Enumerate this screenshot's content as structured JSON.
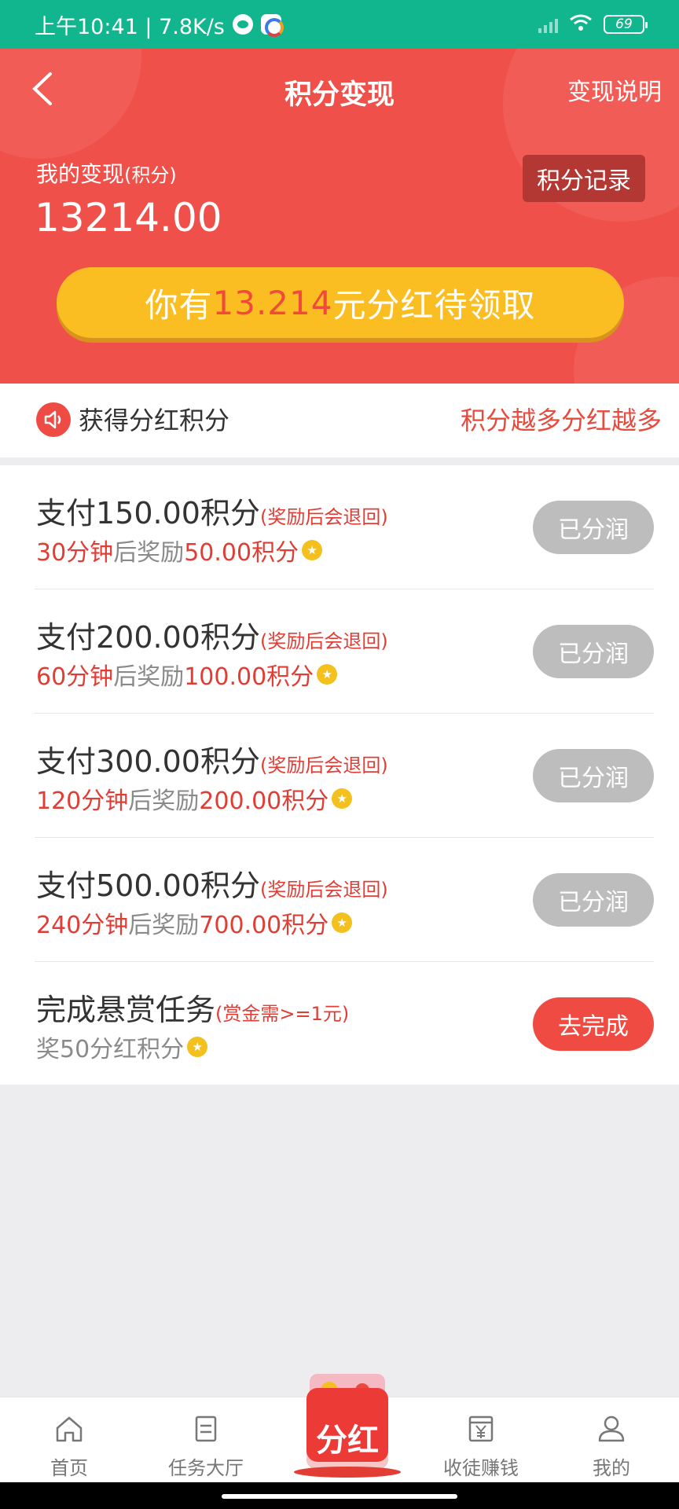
{
  "status_bar": {
    "time_speed": "上午10:41 | 7.8K/s",
    "battery": "69"
  },
  "header": {
    "title": "积分变现",
    "right_link": "变现说明",
    "my_label": "我的变现",
    "my_label_unit": "(积分)",
    "my_value": "13214.00",
    "record_button": "积分记录",
    "dividend_prefix": "你有",
    "dividend_amount": "13.214",
    "dividend_suffix": "元分红待领取"
  },
  "notice": {
    "title": "获得分红积分",
    "slogan": "积分越多分红越多"
  },
  "tasks": [
    {
      "pay": "支付150.00积分",
      "note": "(奖励后会退回)",
      "time": "30分钟",
      "mid": "后奖励",
      "reward": "50.00积分",
      "button": "已分润",
      "state": "done"
    },
    {
      "pay": "支付200.00积分",
      "note": "(奖励后会退回)",
      "time": "60分钟",
      "mid": "后奖励",
      "reward": "100.00积分",
      "button": "已分润",
      "state": "done"
    },
    {
      "pay": "支付300.00积分",
      "note": "(奖励后会退回)",
      "time": "120分钟",
      "mid": "后奖励",
      "reward": "200.00积分",
      "button": "已分润",
      "state": "done"
    },
    {
      "pay": "支付500.00积分",
      "note": "(奖励后会退回)",
      "time": "240分钟",
      "mid": "后奖励",
      "reward": "700.00积分",
      "button": "已分润",
      "state": "done"
    },
    {
      "pay": "完成悬赏任务",
      "note": "(赏金需>=1元)",
      "time": "",
      "mid": "奖50分红积分",
      "reward": "",
      "button": "去完成",
      "state": "go"
    }
  ],
  "tabbar": {
    "home": "首页",
    "tasks": "任务大厅",
    "center": "分红",
    "earn": "收徒赚钱",
    "mine": "我的"
  },
  "colors": {
    "status_green": "#11b58e",
    "header_red": "#f0504a",
    "gold": "#fbbe22",
    "accent_red": "#e23d35",
    "done_gray": "#bdbdbd"
  }
}
